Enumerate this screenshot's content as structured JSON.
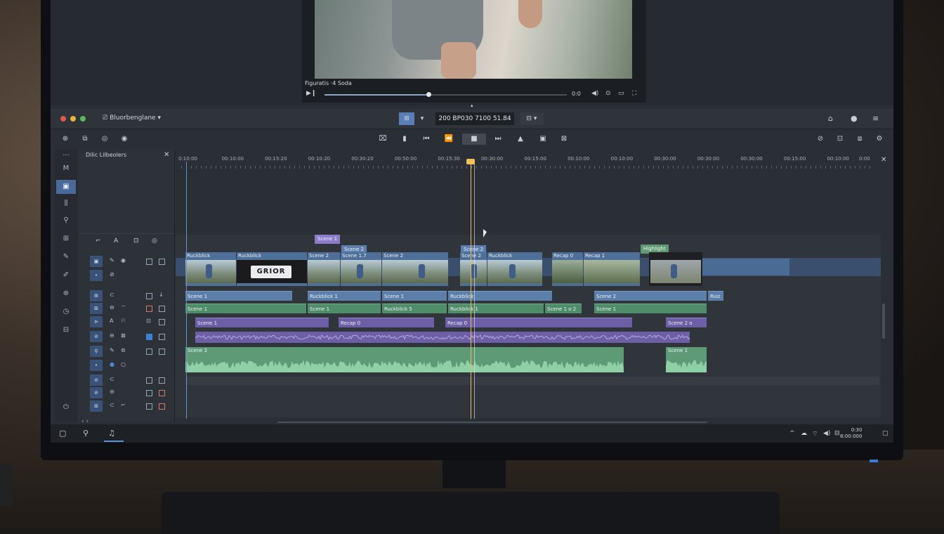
{
  "preview": {
    "title": "Figuratis ·4 Soda",
    "progress": 0.43,
    "time_label": "0:0",
    "icons": [
      "play-icon",
      "volume-icon",
      "settings-icon",
      "display-icon",
      "fullscreen-icon"
    ]
  },
  "titlebar": {
    "app_title": "Bluorbenglane",
    "timecode": "200 BP030 7100 51.84",
    "colors": {
      "close": "#e0584f",
      "minimize": "#e6b33d",
      "maximize": "#58b85a"
    }
  },
  "library": {
    "title": "Dilic Lilbeolers"
  },
  "ruler": {
    "labels": [
      "0:10:00",
      "00:10:00",
      "00:15:20",
      "00:10:20",
      "00:30:20",
      "00:50:00",
      "00:15:30",
      "00:30:00",
      "00:15:00",
      "00:10:00",
      "00:10:00",
      "00:30:00",
      "00:30:00",
      "00:30:00",
      "00:15:00",
      "00:10:00",
      "0:00"
    ]
  },
  "markers": [
    {
      "label": "Scene 1",
      "color": "purple"
    },
    {
      "label": "Scene 2",
      "color": "blue"
    },
    {
      "label": "Scene 2",
      "color": "blue"
    },
    {
      "label": "Highlight",
      "color": "green"
    }
  ],
  "video_clips": [
    {
      "label": "Ruckblick"
    },
    {
      "label": "Ruckblick",
      "logo": "GRIOR"
    },
    {
      "label": "Scene 2"
    },
    {
      "label": "Scene 1.7"
    },
    {
      "label": "Scene 2"
    },
    {
      "label": "Scene 2"
    },
    {
      "label": "Ruckblick"
    },
    {
      "label": "Recap 0"
    },
    {
      "label": "Recap 1"
    }
  ],
  "track1": [
    "Scene 1",
    "Ruckblick 1",
    "Scene 1",
    "Ruckblick",
    "Scene 2",
    "Ruiz"
  ],
  "track2": [
    "Scene 1",
    "Scene 1",
    "Ruckblick 5",
    "Ruckblick 1",
    "Scene 1 o 2",
    "Scene 1"
  ],
  "track3": [
    "Scene 1",
    "Recap 0",
    "Recap 0",
    "Scene 2 o"
  ],
  "audio_clips": [
    "Scene 2",
    "Scene 1"
  ],
  "taskbar": {
    "time": "0:30",
    "date": "8:00:000"
  }
}
